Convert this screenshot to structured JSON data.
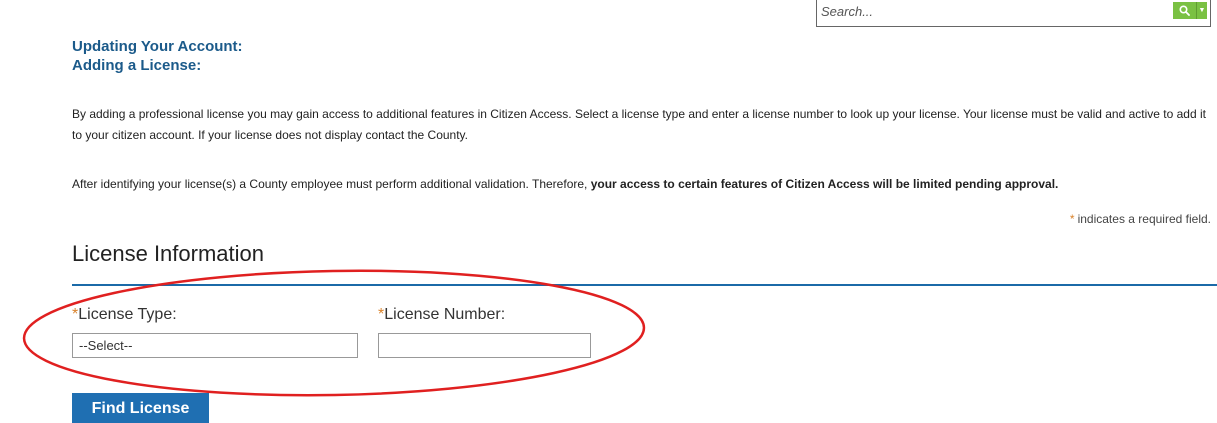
{
  "search": {
    "placeholder": "Search...",
    "button_icon": "magnifier-icon",
    "accent": "#7ac143"
  },
  "headings": {
    "line1": "Updating Your Account:",
    "line2": "Adding a License:",
    "color": "#1b5a8a"
  },
  "intro": {
    "paragraph1": "By adding a professional license you may gain access to additional features in Citizen Access. Select a license type and enter a license number to look up your license. Your license must be valid and active to add it to your citizen account. If your license does not display contact the County.",
    "paragraph2_plain": "After identifying your license(s) a County employee must perform additional validation. Therefore, ",
    "paragraph2_bold": "your access to certain features of Citizen Access will be limited pending approval."
  },
  "required_note": {
    "star": "*",
    "text": "indicates a required field."
  },
  "section": {
    "title": "License Information",
    "rule_color": "#1b6aa8"
  },
  "form": {
    "license_type_label": "License Type:",
    "license_type_value": "--Select--",
    "license_number_label": "License Number:",
    "license_number_value": "",
    "required_star": "*",
    "star_color": "#d9822b"
  },
  "actions": {
    "find_label": "Find License",
    "button_color": "#1f6fb2"
  },
  "annotation": {
    "color": "#e02020"
  }
}
